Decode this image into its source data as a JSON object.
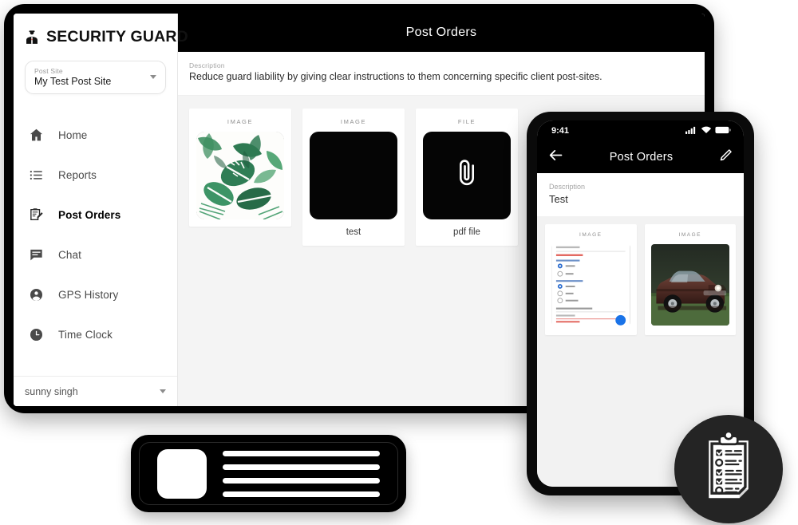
{
  "app": {
    "brand_name": "SECURITY GUARD",
    "brand_icon": "security-guard-icon"
  },
  "sidebar": {
    "site_selector": {
      "label": "Post Site",
      "value": "My Test Post Site",
      "caret_icon": "chevron-down-icon"
    },
    "items": [
      {
        "label": "Home",
        "icon": "home-icon",
        "active": false
      },
      {
        "label": "Reports",
        "icon": "list-icon",
        "active": false
      },
      {
        "label": "Post Orders",
        "icon": "clipboard-pencil-icon",
        "active": true
      },
      {
        "label": "Chat",
        "icon": "chat-icon",
        "active": false
      },
      {
        "label": "GPS History",
        "icon": "account-circle-icon",
        "active": false
      },
      {
        "label": "Time Clock",
        "icon": "clock-icon",
        "active": false
      }
    ],
    "user": {
      "name": "sunny singh",
      "caret_icon": "chevron-down-icon"
    }
  },
  "desktop": {
    "topbar_title": "Post Orders",
    "description": {
      "label": "Description",
      "text": "Reduce guard liability by giving clear instructions to them concerning specific client post-sites."
    },
    "attachments": [
      {
        "type": "IMAGE",
        "name": "",
        "thumb": "tropical-leaves-photo"
      },
      {
        "type": "IMAGE",
        "name": "test",
        "thumb": "black-placeholder"
      },
      {
        "type": "FILE",
        "name": "pdf file",
        "thumb": "paperclip-icon"
      }
    ]
  },
  "phone": {
    "status_bar": {
      "time": "9:41",
      "icons": [
        "signal-icon",
        "wifi-icon",
        "battery-icon"
      ]
    },
    "back_icon": "arrow-left-icon",
    "title": "Post Orders",
    "edit_icon": "pencil-icon",
    "description": {
      "label": "Description",
      "text": "Test"
    },
    "attachments": [
      {
        "type": "IMAGE",
        "thumb": "form-screenshot"
      },
      {
        "type": "IMAGE",
        "thumb": "suv-car-photo"
      }
    ]
  },
  "badge_card": {
    "photo": "id-photo-placeholder",
    "lines": 4
  },
  "clipboard_badge": {
    "icon": "clipboard-checklist-icon",
    "background": "#242424",
    "rows": 6,
    "checked_rows": [
      0,
      2,
      3
    ]
  }
}
